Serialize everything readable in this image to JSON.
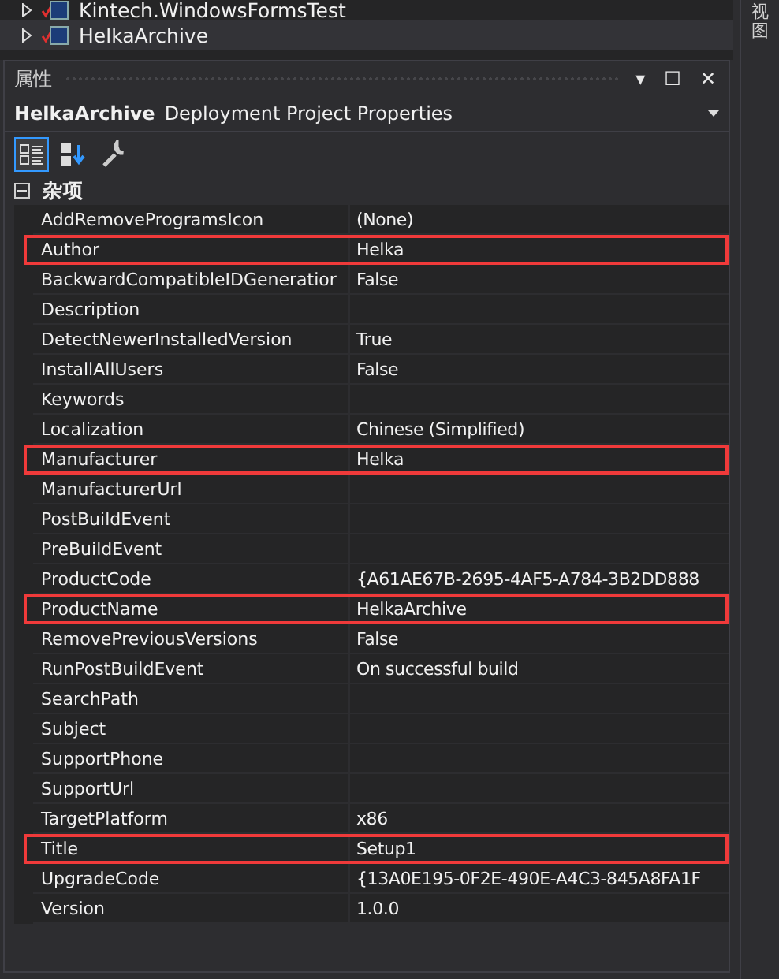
{
  "solution_tree": [
    {
      "label": "Kintech.WindowsFormsTest",
      "expanded": false,
      "selected": false
    },
    {
      "label": "HelkaArchive",
      "expanded": false,
      "selected": true
    }
  ],
  "side_tab": {
    "label": "视图"
  },
  "panel": {
    "title": "属性",
    "buttons": [
      "▾",
      "☐",
      "✕"
    ]
  },
  "object_selector": {
    "name": "HelkaArchive",
    "type": "Deployment Project Properties"
  },
  "toolbar": [
    {
      "kind": "categorized",
      "selected": true
    },
    {
      "kind": "alphabetical",
      "selected": false
    },
    {
      "kind": "property-pages",
      "selected": false
    }
  ],
  "category": {
    "label": "杂项",
    "expanded": true
  },
  "properties": [
    {
      "name": "AddRemoveProgramsIcon",
      "value": "(None)",
      "highlighted": false
    },
    {
      "name": "Author",
      "value": "Helka",
      "highlighted": true
    },
    {
      "name": "BackwardCompatibleIDGeneratior",
      "value": "False",
      "highlighted": false
    },
    {
      "name": "Description",
      "highlighted": false
    },
    {
      "name": "DetectNewerInstalledVersion",
      "value": "True",
      "highlighted": false
    },
    {
      "name": "InstallAllUsers",
      "value": "False",
      "highlighted": false
    },
    {
      "name": "Keywords",
      "highlighted": false
    },
    {
      "name": "Localization",
      "value": "Chinese (Simplified)",
      "highlighted": false
    },
    {
      "name": "Manufacturer",
      "value": "Helka",
      "highlighted": true
    },
    {
      "name": "ManufacturerUrl",
      "highlighted": false
    },
    {
      "name": "PostBuildEvent",
      "highlighted": false
    },
    {
      "name": "PreBuildEvent",
      "highlighted": false
    },
    {
      "name": "ProductCode",
      "value": "{A61AE67B-2695-4AF5-A784-3B2DD888",
      "highlighted": false
    },
    {
      "name": "ProductName",
      "value": "HelkaArchive",
      "highlighted": true
    },
    {
      "name": "RemovePreviousVersions",
      "value": "False",
      "highlighted": false
    },
    {
      "name": "RunPostBuildEvent",
      "value": "On successful build",
      "highlighted": false
    },
    {
      "name": "SearchPath",
      "highlighted": false
    },
    {
      "name": "Subject",
      "highlighted": false
    },
    {
      "name": "SupportPhone",
      "highlighted": false
    },
    {
      "name": "SupportUrl",
      "highlighted": false
    },
    {
      "name": "TargetPlatform",
      "value": "x86",
      "highlighted": false
    },
    {
      "name": "Title",
      "value": "Setup1",
      "highlighted": true
    },
    {
      "name": "UpgradeCode",
      "value": "{13A0E195-0F2E-490E-A4C3-845A8FA1F",
      "highlighted": false
    },
    {
      "name": "Version",
      "value": "1.0.0",
      "highlighted": false
    }
  ]
}
